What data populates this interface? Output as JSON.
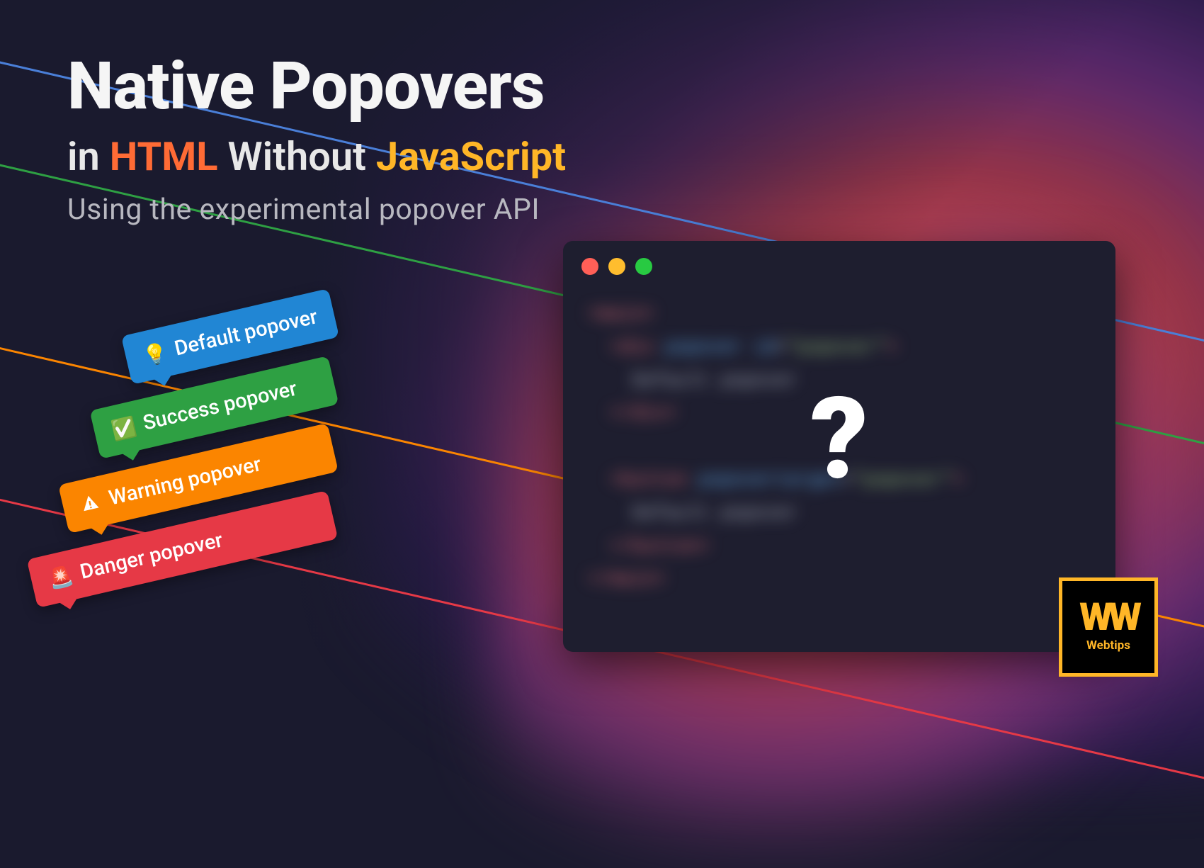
{
  "heading": {
    "title": "Native Popovers",
    "subtitle_prefix": "in ",
    "subtitle_html": "HTML",
    "subtitle_mid": " Without ",
    "subtitle_js": "JavaScript",
    "subtext": "Using the experimental popover API"
  },
  "popovers": [
    {
      "label": "Default popover",
      "icon": "💡",
      "variant": "default"
    },
    {
      "label": "Success popover",
      "icon": "✅",
      "variant": "success"
    },
    {
      "label": "Warning popover",
      "icon": "▲",
      "variant": "warning"
    },
    {
      "label": "Danger popover",
      "icon": "🚨",
      "variant": "danger"
    }
  ],
  "code_window": {
    "overlay_symbol": "?"
  },
  "branding": {
    "mark": "WW",
    "name": "Webtips"
  },
  "colors": {
    "accent_orange": "#ff6b35",
    "accent_yellow": "#ffb627",
    "line_blue": "#4a7fd8",
    "line_green": "#2ea043",
    "line_orange": "#fb8500",
    "line_red": "#e63946"
  }
}
